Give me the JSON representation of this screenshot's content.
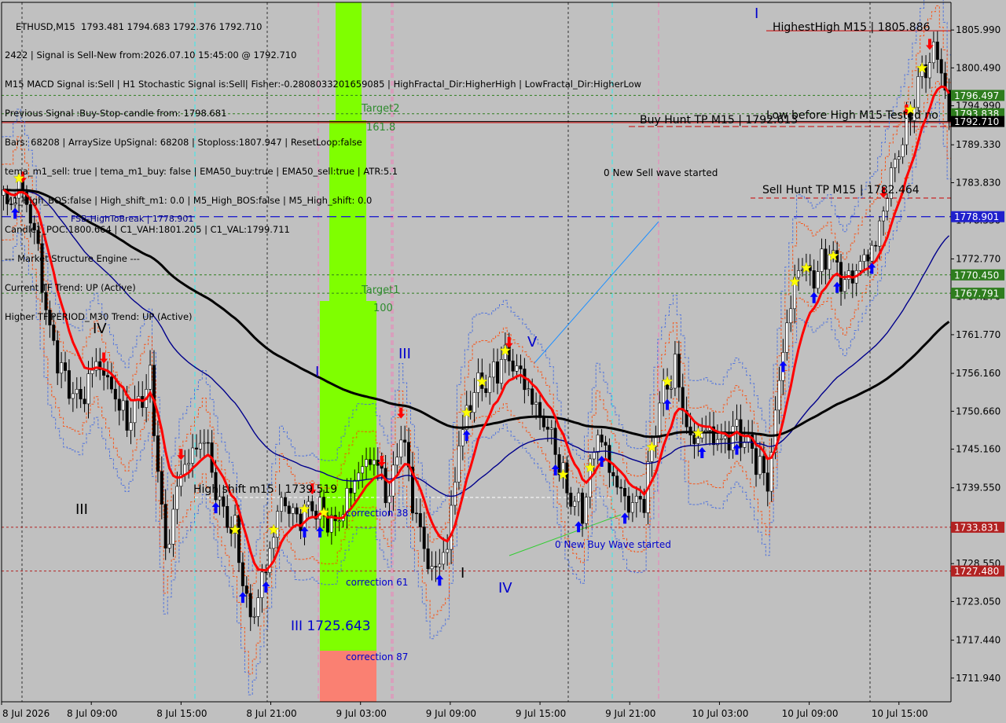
{
  "header_lines": [
    "ETHUSD,M15  1793.481 1794.683 1792.376 1792.710",
    "2422 | Signal is Sell-New from:2026.07.10 15:45:00 @ 1792.710",
    "M15 MACD Signal is:Sell | H1 Stochastic Signal is:Sell| Fisher:-0.2808033201659085 | HighFractal_Dir:HigherHigh | LowFractal_Dir:HigherLow",
    "Previous Signal :Buy-Stop-candle from: 1798.681",
    "Bars: 68208 | ArraySize UpSignal: 68208 | Stoploss:1807.947 | ResetLoop:false",
    "tema_m1_sell: true | tema_m1_buy: false | EMA50_buy:true | EMA50_sell:true | ATR:5.1",
    "M1_High_BOS:false | High_shift_m1: 0.0 | M5_High_BOS:false | M5_High_shift: 0.0",
    "Candle1_POC:1800.664 | C1_VAH:1801.205 | C1_VAL:1799.711",
    "--- Market Structure Engine ---",
    "Current TF Trend: UP (Active)",
    "Higher TF:PERIOD_M30 Trend: UP (Active)"
  ],
  "chart_data": {
    "type": "candlestick",
    "symbol": "ETHUSD",
    "timeframe": "M15",
    "ylim": [
      1708.5,
      1810.0
    ],
    "y_ticks": [
      "1805.990",
      "1800.490",
      "1794.990",
      "1789.330",
      "1783.830",
      "1778.330",
      "1772.770",
      "1767.270",
      "1761.770",
      "1756.160",
      "1750.660",
      "1745.160",
      "1739.550",
      "1733.831",
      "1728.550",
      "1723.050",
      "1717.440",
      "1711.940"
    ],
    "x_ticks": [
      "8 Jul 2026",
      "8 Jul 09:00",
      "8 Jul 15:00",
      "8 Jul 21:00",
      "9 Jul 03:00",
      "9 Jul 09:00",
      "9 Jul 15:00",
      "9 Jul 21:00",
      "10 Jul 03:00",
      "10 Jul 09:00",
      "10 Jul 15:00"
    ],
    "price_key": [
      [
        0,
        1781.5
      ],
      [
        2,
        1780.5
      ],
      [
        4,
        1784.0
      ],
      [
        8,
        1777.0
      ],
      [
        12,
        1762.0
      ],
      [
        16,
        1755.0
      ],
      [
        20,
        1752.0
      ],
      [
        24,
        1758.0
      ],
      [
        28,
        1754.0
      ],
      [
        32,
        1749.0
      ],
      [
        38,
        1755.0
      ],
      [
        42,
        1730.0
      ],
      [
        46,
        1742.0
      ],
      [
        52,
        1747.0
      ],
      [
        56,
        1737.0
      ],
      [
        60,
        1733.0
      ],
      [
        64,
        1720.0
      ],
      [
        68,
        1728.0
      ],
      [
        72,
        1738.0
      ],
      [
        76,
        1735.0
      ],
      [
        80,
        1737.0
      ],
      [
        86,
        1734.0
      ],
      [
        92,
        1742.0
      ],
      [
        96,
        1744.0
      ],
      [
        100,
        1738.0
      ],
      [
        103,
        1748.0
      ],
      [
        107,
        1735.0
      ],
      [
        111,
        1727.0
      ],
      [
        115,
        1731.0
      ],
      [
        118,
        1746.0
      ],
      [
        122,
        1754.0
      ],
      [
        126,
        1755.0
      ],
      [
        130,
        1759.0
      ],
      [
        134,
        1756.0
      ],
      [
        138,
        1751.0
      ],
      [
        142,
        1747.0
      ],
      [
        146,
        1739.0
      ],
      [
        150,
        1736.0
      ],
      [
        154,
        1748.0
      ],
      [
        158,
        1741.0
      ],
      [
        162,
        1737.0
      ],
      [
        166,
        1738.0
      ],
      [
        170,
        1752.0
      ],
      [
        174,
        1757.0
      ],
      [
        178,
        1746.0
      ],
      [
        182,
        1748.0
      ],
      [
        186,
        1746.0
      ],
      [
        190,
        1748.0
      ],
      [
        194,
        1745.0
      ],
      [
        198,
        1740.0
      ],
      [
        202,
        1760.0
      ],
      [
        206,
        1772.0
      ],
      [
        210,
        1770.0
      ],
      [
        214,
        1774.0
      ],
      [
        218,
        1769.0
      ],
      [
        222,
        1772.0
      ],
      [
        226,
        1775.0
      ],
      [
        230,
        1785.0
      ],
      [
        234,
        1792.0
      ],
      [
        238,
        1800.0
      ],
      [
        242,
        1803.0
      ],
      [
        244,
        1797.0
      ],
      [
        245,
        1792.71
      ]
    ],
    "levels": [
      {
        "price": 1805.886,
        "label": "HighestHigh   M15 | 1805.886",
        "color": "#cc0000",
        "style": "solid"
      },
      {
        "price": 1796.497,
        "label": "1796.497",
        "color": "#2e7d1e",
        "style": "dot"
      },
      {
        "price": 1793.838,
        "label": "1793.838",
        "color": "#2e7d1e",
        "style": "dot"
      },
      {
        "price": 1792.71,
        "label": "1792.710",
        "color": "#000000",
        "style": "solid"
      },
      {
        "price": 1778.901,
        "label": "1778.901",
        "color": "#2020cc",
        "style": "dash"
      },
      {
        "price": 1770.45,
        "label": "1770.450",
        "color": "#2e7d1e",
        "style": "dot"
      },
      {
        "price": 1767.791,
        "label": "1767.791",
        "color": "#2e7d1e",
        "style": "dot"
      },
      {
        "price": 1733.831,
        "label": "1733.831",
        "color": "#b22222",
        "style": "dot"
      },
      {
        "price": 1727.48,
        "label": "1727.480",
        "color": "#b22222",
        "style": "dot"
      }
    ],
    "annotations": {
      "highest_high": "HighestHigh   M15 | 1805.886",
      "low_before_high": "Low before High  M15-Tested no",
      "buy_hunt": "Buy Hunt TP M15 | 1792.613",
      "sell_hunt": "Sell Hunt TP M15 | 1782.464",
      "new_sell_wave": "0 New Sell wave started",
      "new_buy_wave": "0 New Buy Wave started",
      "fsb": "FSB-HighToBreak | 1778.901",
      "high_shift": "High shift m15 | 1739.519",
      "wave_low": "III 1725.643",
      "target2": "Target2",
      "fib_161": "161.8",
      "target1": "Target1",
      "fib_100": "100",
      "correction38": "correction 38",
      "correction61": "correction 61",
      "correction87": "correction 87",
      "waves": [
        "IV",
        "III",
        "I",
        "III",
        "V",
        "I",
        "IV",
        "I"
      ]
    },
    "colors": {
      "background": "#c0c0c0",
      "candle": "#000000",
      "ema_fast": "#ff0000",
      "ema_mid": "#00008b",
      "ema_slow": "#000000",
      "zone_green": "#7fff00",
      "zone_red": "#fa8072",
      "buy_arrow": "#0000ff",
      "sell_arrow": "#ff0000",
      "star": "#ffff00"
    }
  }
}
